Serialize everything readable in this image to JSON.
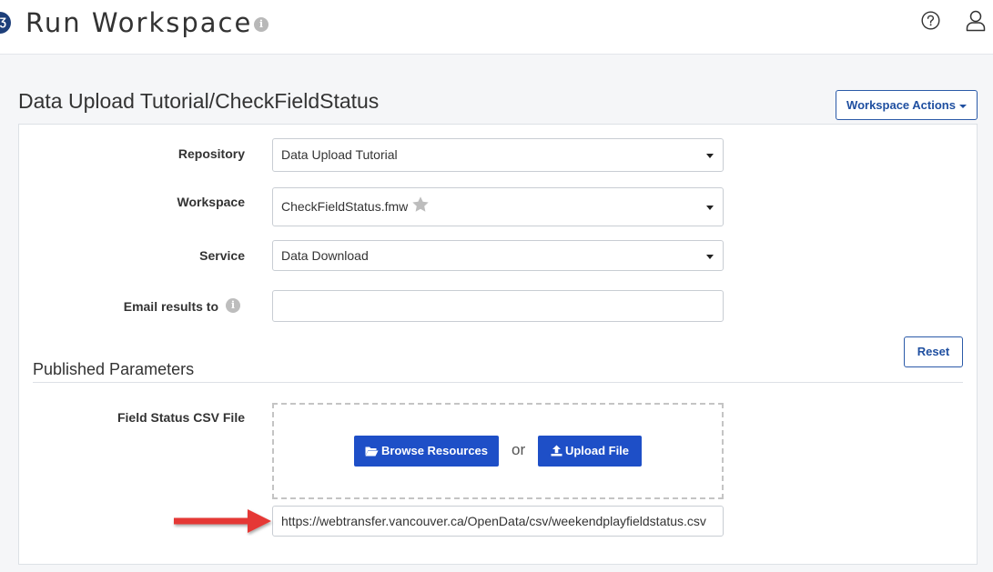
{
  "header": {
    "logo_glyph": "Ʒ",
    "title": "Run Workspace",
    "title_info_glyph": "i",
    "help_icon": "question-circle-icon",
    "user_icon": "user-icon"
  },
  "page": {
    "heading": "Data Upload Tutorial/CheckFieldStatus",
    "workspace_actions_label": "Workspace Actions"
  },
  "form": {
    "repository": {
      "label": "Repository",
      "value": "Data Upload Tutorial"
    },
    "workspace": {
      "label": "Workspace",
      "value": "CheckFieldStatus.fmw"
    },
    "service": {
      "label": "Service",
      "value": "Data Download"
    },
    "email": {
      "label": "Email results to",
      "value": "",
      "info_glyph": "i"
    }
  },
  "published_parameters": {
    "reset_label": "Reset",
    "title": "Published Parameters",
    "field_status": {
      "label": "Field Status CSV File",
      "browse_label": "Browse Resources",
      "or_text": "or",
      "upload_label": "Upload File",
      "url_value": "https://webtransfer.vancouver.ca/OpenData/csv/weekendplayfieldstatus.csv"
    }
  },
  "colors": {
    "accent": "#1e4fc7",
    "arrow": "#e53935",
    "background": "#f5f6f8"
  }
}
